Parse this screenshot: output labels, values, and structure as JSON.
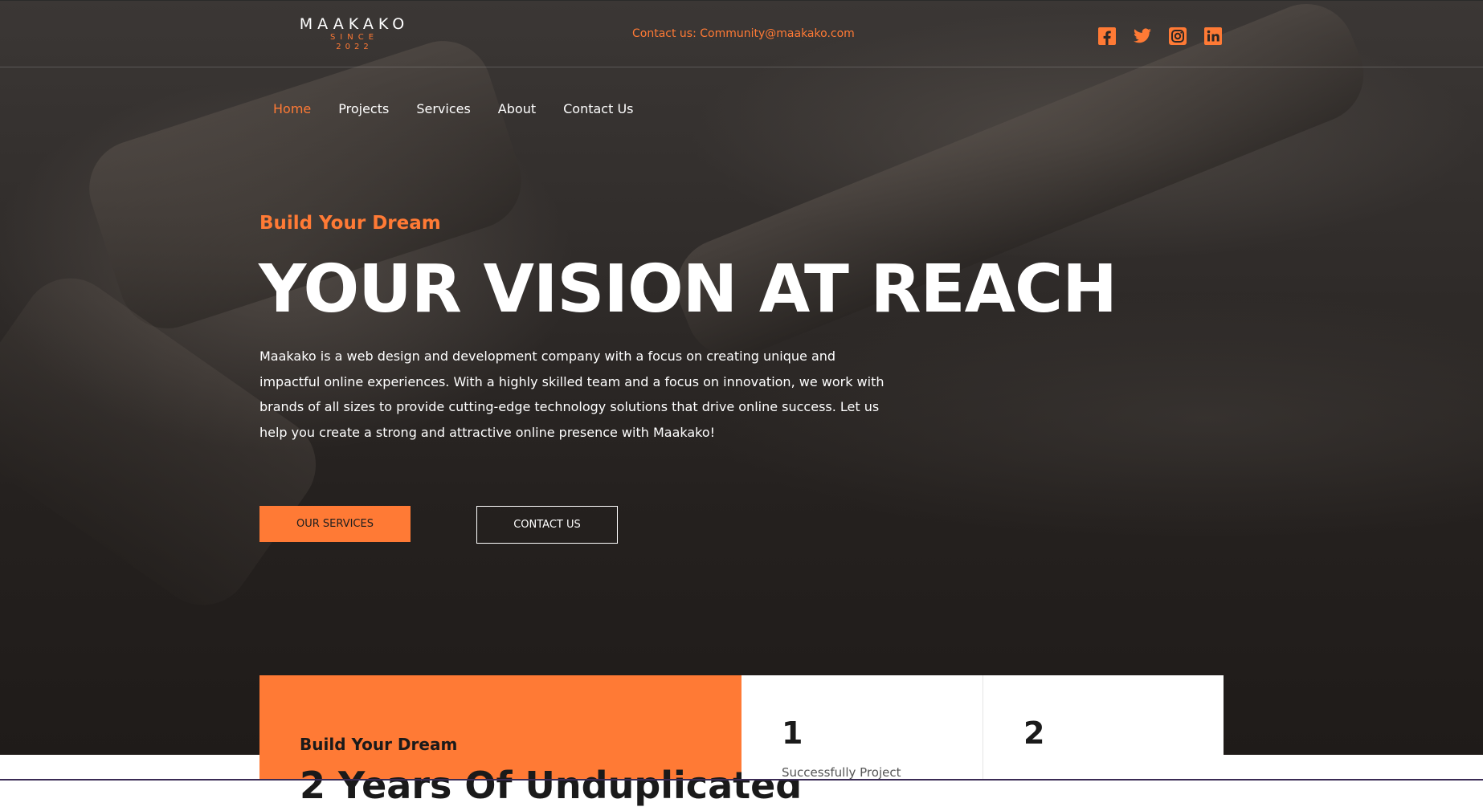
{
  "colors": {
    "accent": "#ff7a35",
    "hero_bg": "#2b2725",
    "text_light": "#ffffff",
    "stats_bg": "#ffffff"
  },
  "logo": {
    "name": "MAAKAKO",
    "since": "SINCE",
    "year": "2022"
  },
  "header": {
    "contact": "Contact us: Community@maakako.com"
  },
  "social": [
    "facebook-icon",
    "twitter-icon",
    "instagram-icon",
    "linkedin-icon"
  ],
  "nav": {
    "items": [
      {
        "label": "Home",
        "active": true
      },
      {
        "label": "Projects"
      },
      {
        "label": "Services"
      },
      {
        "label": "About"
      },
      {
        "label": "Contact Us"
      }
    ]
  },
  "hero": {
    "eyebrow": "Build Your Dream",
    "headline": "YOUR VISION AT REACH",
    "description": "Maakako is a web design and development company with a focus on creating unique and impactful online experiences. With a highly skilled team and a focus on innovation, we work with brands of all sizes to provide cutting-edge technology solutions that drive online success. Let us help you create a strong and attractive online presence with Maakako!",
    "primary_button": "OUR SERVICES",
    "secondary_button": "CONTACT US"
  },
  "stats": {
    "kicker": "Build Your Dream",
    "heading": "2 Years Of Unduplicated",
    "cards": [
      {
        "number": "1",
        "label": "Successfully Project"
      },
      {
        "number": "2",
        "label": ""
      }
    ]
  }
}
